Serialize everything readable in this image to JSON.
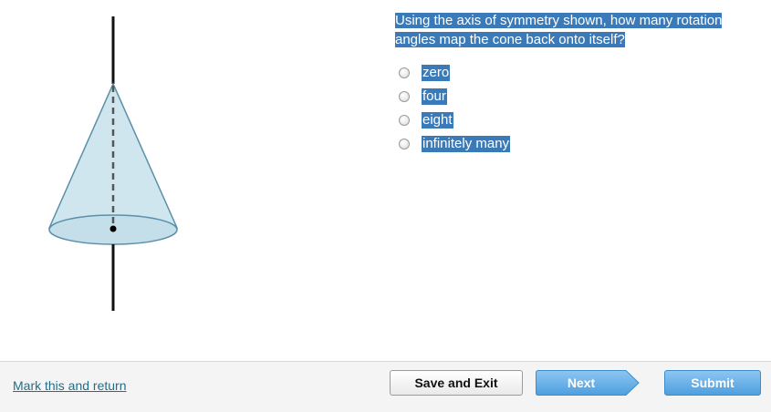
{
  "question": {
    "text_line1": "Using the axis of symmetry shown, how many rotation",
    "text_line2": "angles map the cone back onto itself?"
  },
  "options": [
    {
      "label": "zero",
      "selected": false
    },
    {
      "label": "four",
      "selected": false
    },
    {
      "label": "eight",
      "selected": false
    },
    {
      "label": "infinitely many",
      "selected": false
    }
  ],
  "footer": {
    "mark_link": "Mark this and return",
    "save_label": "Save and Exit",
    "next_label": "Next",
    "submit_label": "Submit"
  },
  "colors": {
    "highlight": "#3a7ab8",
    "cone_fill": "#cfe6ef",
    "cone_stroke": "#5a8fa8",
    "next_button": "#5eaee8",
    "link": "#1f6f8b"
  }
}
